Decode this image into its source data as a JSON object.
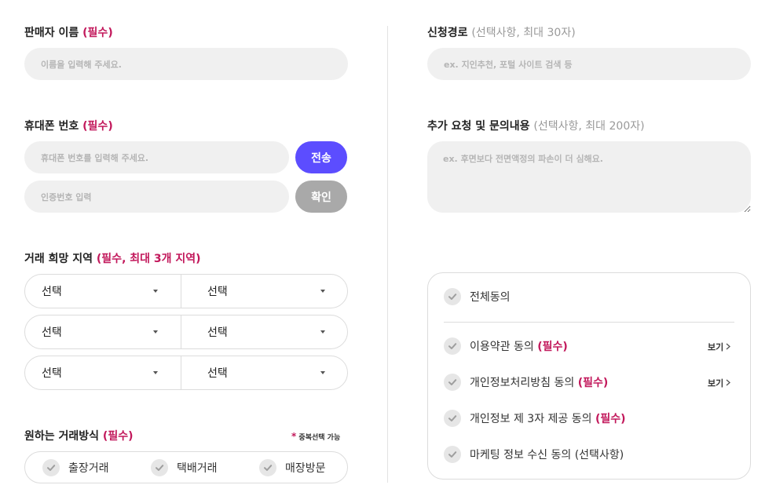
{
  "seller_name": {
    "label": "판매자 이름",
    "required": "(필수)",
    "placeholder": "이름을 입력해 주세요."
  },
  "phone": {
    "label": "휴대폰 번호",
    "required": "(필수)",
    "placeholder": "휴대폰 번호를 입력해 주세요.",
    "send_label": "전송",
    "code_placeholder": "인증번호 입력",
    "confirm_label": "확인",
    "send_color": "#5c4dff",
    "confirm_color": "#a9a9a9"
  },
  "region": {
    "label": "거래 희망 지역",
    "required": "(필수, 최대 3개 지역)",
    "rows": [
      {
        "left": "선택",
        "right": "선택"
      },
      {
        "left": "선택",
        "right": "선택"
      },
      {
        "left": "선택",
        "right": "선택"
      }
    ]
  },
  "trade_method": {
    "label": "원하는 거래방식",
    "required": "(필수)",
    "multi_mark": "*",
    "multi_note": "중복선택 가능",
    "options": [
      "출장거래",
      "택배거래",
      "매장방문"
    ]
  },
  "source": {
    "label": "신청경로",
    "optional": "(선택사항, 최대 30자)",
    "placeholder": "ex. 지인추천, 포털 사이트 검색 등"
  },
  "inquiry": {
    "label": "추가 요청 및 문의내용",
    "optional": "(선택사항, 최대 200자)",
    "placeholder": "ex. 후면보다 전면액정의 파손이 더 심해요."
  },
  "agreements": {
    "all_label": "전체동의",
    "items": [
      {
        "text": "이용약관 동의",
        "tag": "(필수)",
        "link": "보기"
      },
      {
        "text": "개인정보처리방침 동의",
        "tag": "(필수)",
        "link": "보기"
      },
      {
        "text": "개인정보 제 3자 제공 동의",
        "tag": "(필수)",
        "link": ""
      },
      {
        "text": "마케팅 정보 수신 동의 (선택사항)",
        "tag": "",
        "link": ""
      }
    ]
  },
  "colors": {
    "required": "#c2185b",
    "accent": "#5c4dff",
    "check": "#9e9e9e"
  }
}
